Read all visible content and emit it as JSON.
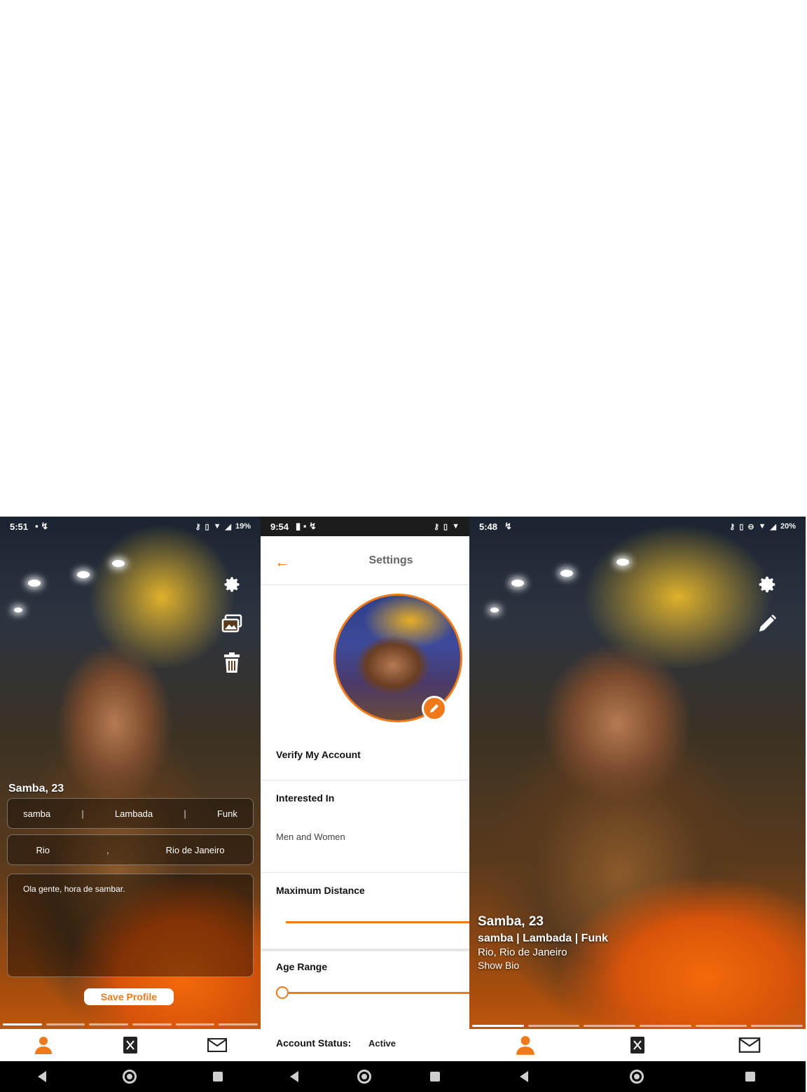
{
  "screen1": {
    "status": {
      "time": "5:51",
      "battery": "19%"
    },
    "name_age": "Samba, 23",
    "interests": [
      "samba",
      "Lambada",
      "Funk"
    ],
    "separator": "|",
    "city": "Rio",
    "location_separator": ",",
    "state": "Rio de Janeiro",
    "bio": "Ola gente, hora de sambar.",
    "save_label": "Save Profile",
    "icons": [
      "gear-icon",
      "gallery-icon",
      "trash-icon"
    ],
    "tabs": [
      "profile-icon",
      "cards-icon",
      "mail-icon"
    ],
    "story_bars": 6
  },
  "screen2": {
    "status": {
      "time": "9:54"
    },
    "title": "Settings",
    "verify_label": "Verify My Account",
    "interested_label": "Interested In",
    "interested_value": "Men and Women",
    "distance_label": "Maximum Distance",
    "age_label": "Age Range",
    "account_status_label": "Account Status:",
    "account_status_value": "Active"
  },
  "screen3": {
    "status": {
      "time": "5:48",
      "battery": "20%"
    },
    "name_age": "Samba, 23",
    "interests_line": "samba | Lambada | Funk",
    "location_line": "Rio, Rio de Janeiro",
    "show_bio_label": "Show Bio",
    "icons": [
      "gear-icon",
      "pencil-icon"
    ],
    "tabs": [
      "profile-icon",
      "cards-icon",
      "mail-icon"
    ],
    "story_bars": 6
  },
  "colors": {
    "accent": "#f07a1a",
    "navbar": "#000000",
    "white": "#ffffff"
  }
}
